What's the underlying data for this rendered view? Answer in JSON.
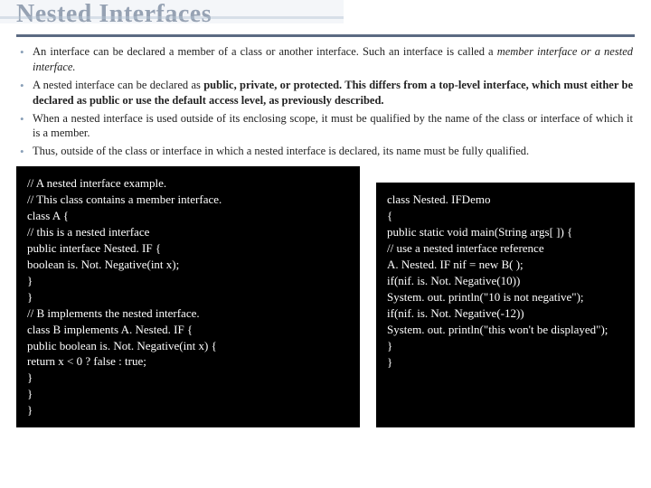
{
  "title": "Nested Interfaces",
  "bullets": [
    {
      "pre": "An interface can be declared a member of a class or another interface. Such an interface is called a ",
      "em": "member interface or a nested interface.",
      "post": ""
    },
    {
      "pre": "A nested interface can be declared as ",
      "bold": "public, private, or protected. This differs from a top-level interface, which must either be declared as public or use the default access level, as previously described.",
      "post": ""
    },
    {
      "pre": "When a nested interface is used outside of its enclosing scope, it must be qualified by the name of the class or interface of which it is a member.",
      "em": "",
      "post": ""
    },
    {
      "pre": "Thus, outside of the class or interface in which a nested interface is declared, its name must be fully qualified.",
      "em": "",
      "post": ""
    }
  ],
  "code_left": "// A nested interface example.\n// This class contains a member interface.\nclass A {\n// this is a nested interface\npublic interface Nested. IF {\nboolean is. Not. Negative(int x);\n}\n}\n// B implements the nested interface.\nclass B implements A. Nested. IF {\npublic boolean is. Not. Negative(int x) {\nreturn x < 0 ? false : true;\n}\n}\n}",
  "code_right": "class Nested. IFDemo\n{\npublic static void main(String args[ ]) {\n// use a nested interface reference\nA. Nested. IF nif = new B( );\nif(nif. is. Not. Negative(10))\nSystem. out. println(\"10 is not negative\");\nif(nif. is. Not. Negative(-12))\nSystem. out. println(\"this won't be displayed\");\n}\n}"
}
